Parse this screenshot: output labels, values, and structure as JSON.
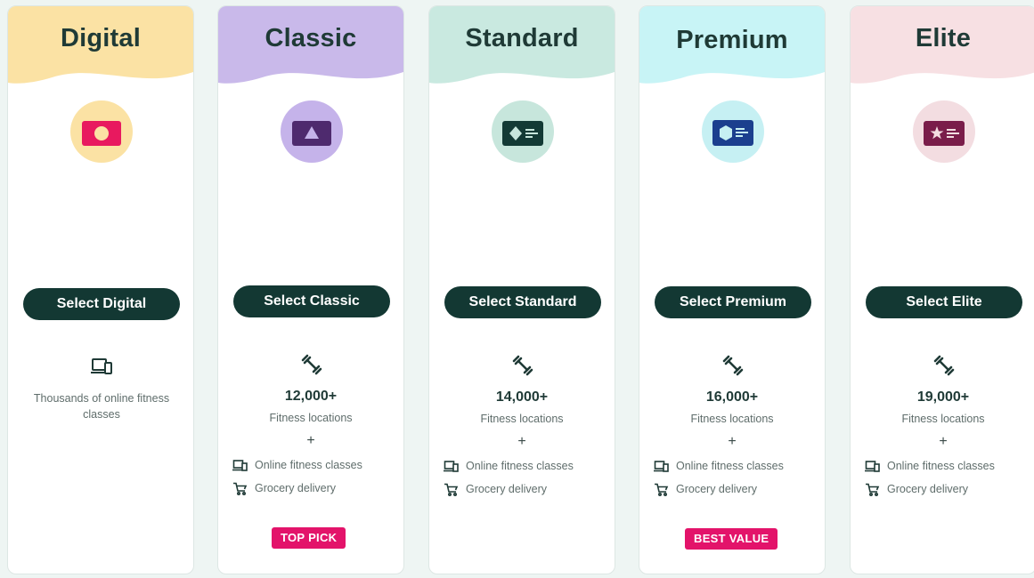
{
  "plans": [
    {
      "id": "digital",
      "name": "Digital",
      "header_color": "#fbe2a4",
      "badge_bg": "#fbe2a4",
      "card_color": "#e8195f",
      "button_label": "Select Digital",
      "feature_icon": "devices-icon",
      "description": "Thousands of online fitness classes"
    },
    {
      "id": "classic",
      "name": "Classic",
      "header_color": "#c9b9ea",
      "badge_bg": "#c5b3ea",
      "card_color": "#4e2a6e",
      "button_label": "Select Classic",
      "feature_icon": "dumbbell-icon",
      "locations": "12,000+",
      "locations_label": "Fitness locations",
      "plus": "+",
      "perks": [
        {
          "icon": "devices-icon",
          "label": "Online fitness classes"
        },
        {
          "icon": "cart-icon",
          "label": "Grocery delivery"
        }
      ],
      "tag": "TOP PICK"
    },
    {
      "id": "standard",
      "name": "Standard",
      "header_color": "#c9e9e0",
      "badge_bg": "#c7e6dc",
      "card_color": "#133a35",
      "button_label": "Select Standard",
      "feature_icon": "dumbbell-icon",
      "locations": "14,000+",
      "locations_label": "Fitness locations",
      "plus": "+",
      "perks": [
        {
          "icon": "devices-icon",
          "label": "Online fitness classes"
        },
        {
          "icon": "cart-icon",
          "label": "Grocery delivery"
        }
      ]
    },
    {
      "id": "premium",
      "name": "Premium",
      "header_color": "#c8f4f6",
      "badge_bg": "#c6f0f3",
      "card_color": "#1b3f8e",
      "button_label": "Select Premium",
      "feature_icon": "dumbbell-icon",
      "locations": "16,000+",
      "locations_label": "Fitness locations",
      "plus": "+",
      "perks": [
        {
          "icon": "devices-icon",
          "label": "Online fitness classes"
        },
        {
          "icon": "cart-icon",
          "label": "Grocery delivery"
        }
      ],
      "tag": "BEST VALUE"
    },
    {
      "id": "elite",
      "name": "Elite",
      "header_color": "#f7e0e3",
      "badge_bg": "#f3dde1",
      "card_color": "#7a1d4a",
      "button_label": "Select Elite",
      "feature_icon": "dumbbell-icon",
      "locations": "19,000+",
      "locations_label": "Fitness locations",
      "plus": "+",
      "perks": [
        {
          "icon": "devices-icon",
          "label": "Online fitness classes"
        },
        {
          "icon": "cart-icon",
          "label": "Grocery delivery"
        }
      ]
    }
  ]
}
